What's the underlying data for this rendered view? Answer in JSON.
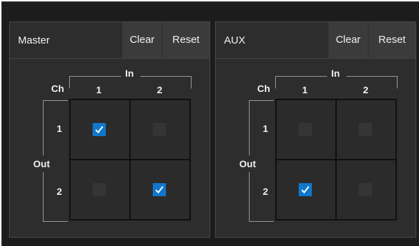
{
  "panels": [
    {
      "title": "Master",
      "clear_label": "Clear",
      "reset_label": "Reset",
      "in_label": "In",
      "ch_label": "Ch",
      "out_label": "Out",
      "in_channels": [
        "1",
        "2"
      ],
      "out_channels": [
        "1",
        "2"
      ],
      "routing": [
        [
          true,
          false
        ],
        [
          false,
          true
        ]
      ]
    },
    {
      "title": "AUX",
      "clear_label": "Clear",
      "reset_label": "Reset",
      "in_label": "In",
      "ch_label": "Ch",
      "out_label": "Out",
      "in_channels": [
        "1",
        "2"
      ],
      "out_channels": [
        "1",
        "2"
      ],
      "routing": [
        [
          false,
          false
        ],
        [
          true,
          false
        ]
      ]
    }
  ],
  "colors": {
    "background": "#1c1c1c",
    "panel": "#2d2d2d",
    "button": "#3b3b3b",
    "checkbox_on": "#1177cc",
    "checkbox_off": "#353535"
  },
  "icons": {
    "checked": "checkmark-icon"
  }
}
